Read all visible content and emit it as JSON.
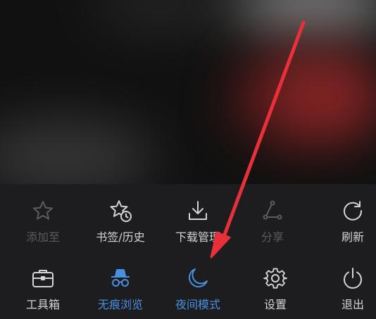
{
  "colors": {
    "panel": "#1d1d1f",
    "text": "#d4d4d4",
    "disabled": "#5c5c5c",
    "active": "#4a90e2",
    "arrow": "#e8303a"
  },
  "menu": {
    "row1": [
      {
        "label": "添加至",
        "icon": "star-icon",
        "state": "disabled"
      },
      {
        "label": "书签/历史",
        "icon": "star-clock-icon",
        "state": "normal"
      },
      {
        "label": "下载管理",
        "icon": "download-icon",
        "state": "normal"
      },
      {
        "label": "分享",
        "icon": "share-icon",
        "state": "disabled"
      },
      {
        "label": "刷新",
        "icon": "refresh-icon",
        "state": "normal"
      }
    ],
    "row2": [
      {
        "label": "工具箱",
        "icon": "toolbox-icon",
        "state": "normal"
      },
      {
        "label": "无痕浏览",
        "icon": "incognito-icon",
        "state": "active"
      },
      {
        "label": "夜间模式",
        "icon": "moon-icon",
        "state": "active"
      },
      {
        "label": "设置",
        "icon": "gear-icon",
        "state": "normal"
      },
      {
        "label": "退出",
        "icon": "power-icon",
        "state": "normal"
      }
    ]
  }
}
